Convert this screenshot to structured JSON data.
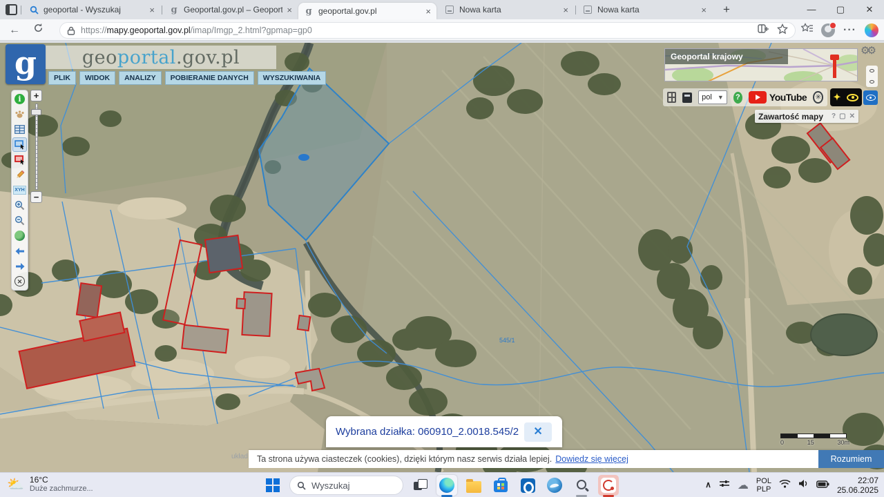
{
  "browser": {
    "tabs": [
      {
        "label": "geoportal - Wyszukaj"
      },
      {
        "label": "Geoportal.gov.pl – Geoportal Infr"
      },
      {
        "label": "geoportal.gov.pl"
      },
      {
        "label": "Nowa karta"
      },
      {
        "label": "Nowa karta"
      }
    ],
    "url": {
      "scheme": "https://",
      "host": "mapy.geoportal.gov.pl",
      "path": "/imap/Imgp_2.html?gpmap=gp0"
    }
  },
  "geoportal": {
    "title": {
      "part1": "geo",
      "part2": "portal",
      "part3": ".gov.pl"
    },
    "menu": [
      "PLIK",
      "WIDOK",
      "ANALIZY",
      "POBIERANIE DANYCH",
      "WYSZUKIWANIA"
    ],
    "toolbar_xyh": "XYH",
    "overview_label": "Geoportal krajowy",
    "language": "pol",
    "youtube_label": "YouTube",
    "map_contents": {
      "title": "Zawartość mapy",
      "help": "?"
    },
    "parcel_popup": {
      "text": "Wybrana działka: 060910_2.0018.545/2"
    },
    "scale_bar": {
      "start": "0",
      "mid": "15",
      "end": "30m"
    },
    "map_label_parcel": "545/1",
    "coord_text": "układ"
  },
  "cookie": {
    "text": "Ta strona używa ciasteczek (cookies), dzięki którym nasz serwis działa lepiej.",
    "link_label": "Dowiedz się więcej",
    "accept_label": "Rozumiem"
  },
  "taskbar": {
    "temperature": "16°C",
    "weather": "Duże zachmurze...",
    "search_placeholder": "Wyszukaj",
    "lang_line1": "POL",
    "lang_line2": "PLP",
    "time": "22:07",
    "date": "25.06.2025"
  }
}
